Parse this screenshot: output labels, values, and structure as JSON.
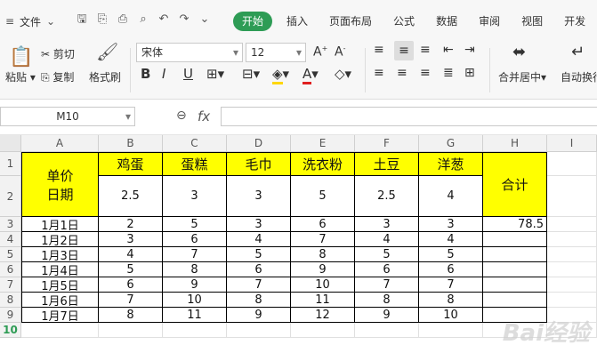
{
  "menubar": {
    "file_label": "文件",
    "tabs": [
      "开始",
      "插入",
      "页面布局",
      "公式",
      "数据",
      "审阅",
      "视图",
      "开发"
    ],
    "active_tab": "开始"
  },
  "ribbon": {
    "paste": "粘贴",
    "cut": "剪切",
    "copy": "复制",
    "format_painter": "格式刷",
    "font_name": "宋体",
    "font_size": "12",
    "merge_center": "合并居中",
    "auto_wrap": "自动换行"
  },
  "formula_bar": {
    "name_box": "M10",
    "fx": "fx",
    "formula": ""
  },
  "sheet": {
    "columns": [
      "A",
      "B",
      "C",
      "D",
      "E",
      "F",
      "G",
      "H",
      "I"
    ],
    "rows": [
      "1",
      "2",
      "3",
      "4",
      "5",
      "6",
      "7",
      "8",
      "9",
      "10"
    ],
    "header_label": "单价\n日期",
    "items": [
      "鸡蛋",
      "蛋糕",
      "毛巾",
      "洗衣粉",
      "土豆",
      "洋葱"
    ],
    "prices": [
      "2.5",
      "3",
      "3",
      "5",
      "2.5",
      "4"
    ],
    "total_label": "合计",
    "dates": [
      "1月1日",
      "1月2日",
      "1月3日",
      "1月4日",
      "1月5日",
      "1月6日",
      "1月7日"
    ],
    "data": [
      [
        "2",
        "5",
        "3",
        "6",
        "3",
        "3"
      ],
      [
        "3",
        "6",
        "4",
        "7",
        "4",
        "4"
      ],
      [
        "4",
        "7",
        "5",
        "8",
        "5",
        "5"
      ],
      [
        "5",
        "8",
        "6",
        "9",
        "6",
        "6"
      ],
      [
        "6",
        "9",
        "7",
        "10",
        "7",
        "7"
      ],
      [
        "7",
        "10",
        "8",
        "11",
        "8",
        "8"
      ],
      [
        "8",
        "11",
        "9",
        "12",
        "9",
        "10"
      ]
    ],
    "total_value": "78.5"
  },
  "watermark": "Bai经验",
  "colors": {
    "accent": "#2e9c55",
    "yellow": "#ffff00"
  }
}
